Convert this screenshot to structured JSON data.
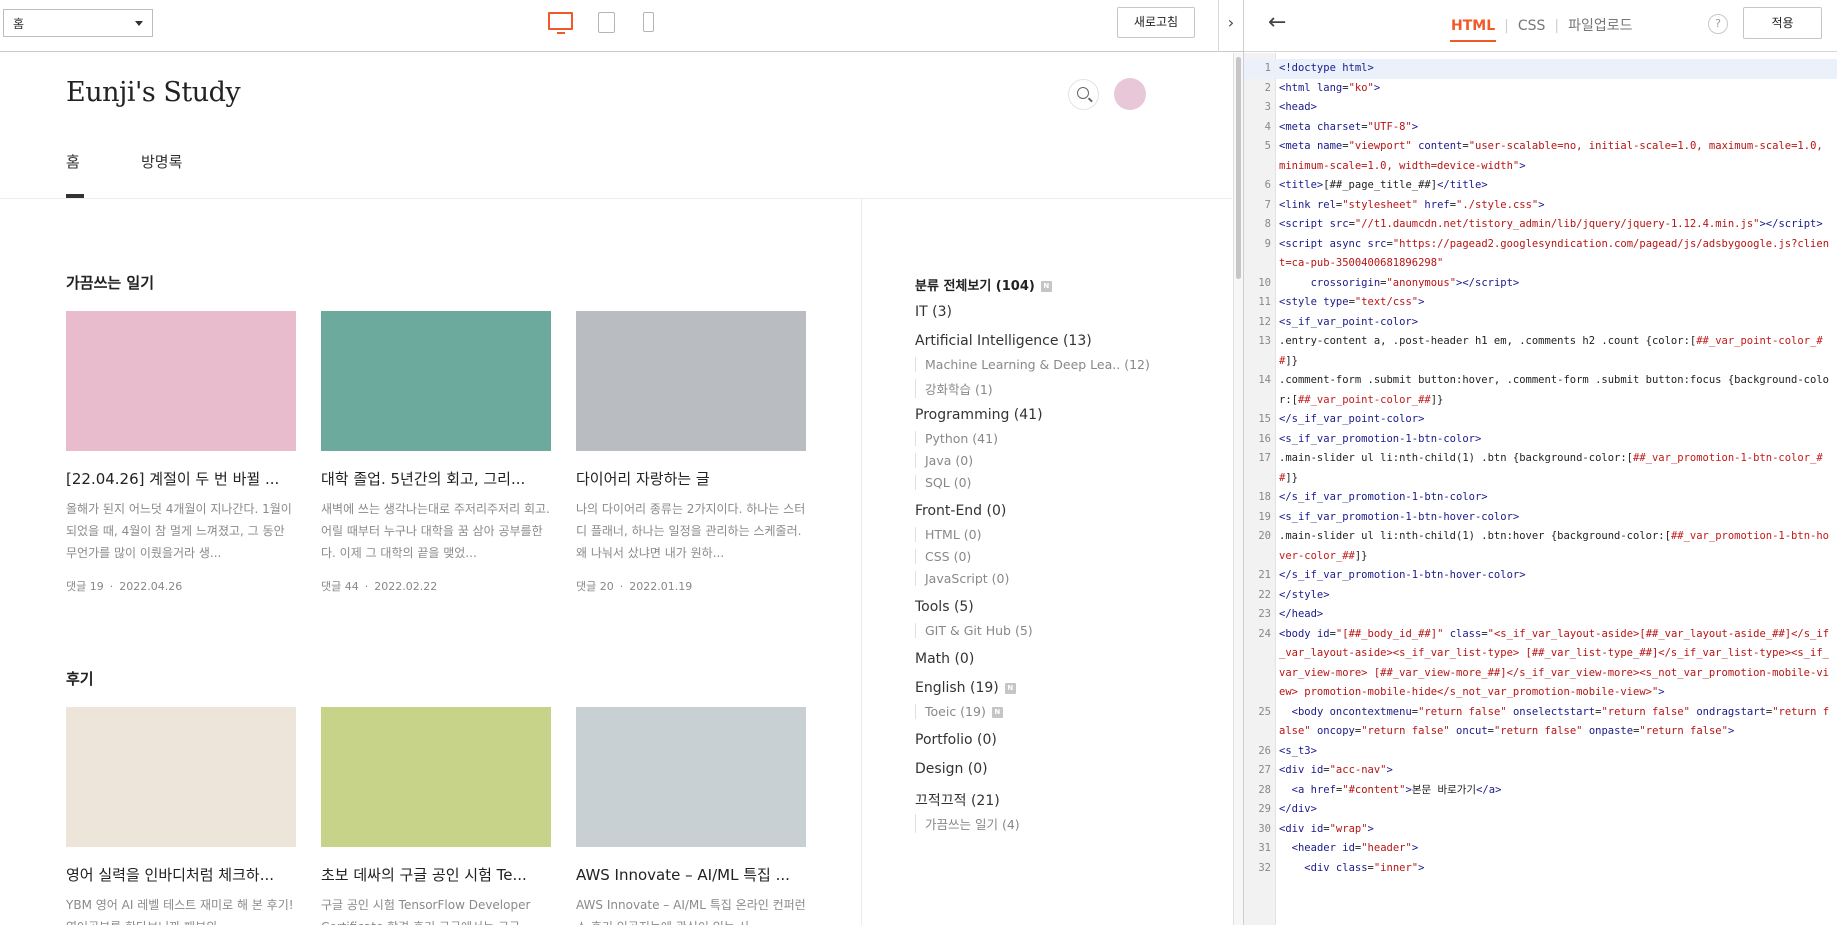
{
  "toolbar": {
    "page_select": "홈",
    "devices": [
      "desktop-icon",
      "tablet-icon",
      "mobile-icon"
    ],
    "refresh_label": "새로고침",
    "collapse_glyph": "›"
  },
  "blog": {
    "title": "Eunji's Study",
    "nav": [
      "홈",
      "방명록"
    ],
    "sections": [
      {
        "title": "가끔쓰는 일기",
        "posts": [
          {
            "title": "[22.04.26] 계절이 두 번 바뀔 ...",
            "excerpt": "올해가 된지 어느덧 4개월이 지나간다. 1월이 되었을 때, 4월이 참 멀게 느껴졌고, 그 동안 무언가를 많이 이뤘을거라 생...",
            "comments": "댓글 19",
            "date": "2022.04.26",
            "color": "#e8bccc"
          },
          {
            "title": "대학 졸업. 5년간의 회고, 그리...",
            "excerpt": "새벽에 쓰는 생각나는대로 주저리주저리 회고. 어릴 때부터 누구나 대학을 꿈 삼아 공부를한다. 이제 그 대학의 끝을 맺었...",
            "comments": "댓글 44",
            "date": "2022.02.22",
            "color": "#6caa9d"
          },
          {
            "title": "다이어리 자랑하는 글",
            "excerpt": "나의 다이어리 종류는 2가지이다. 하나는 스터디 플래너, 하나는 일정을 관리하는 스케줄러. 왜 나눠서 샀냐면 내가 원하...",
            "comments": "댓글 20",
            "date": "2022.01.19",
            "color": "#b9bcc0"
          }
        ]
      },
      {
        "title": "후기",
        "posts": [
          {
            "title": "영어 실력을 인바디처럼 체크하...",
            "excerpt": "YBM 영어 AI 레벨 테스트 재미로 해 본 후기! 영어공부를 한다보니까 패부의",
            "comments": "",
            "date": "",
            "color": "#ede5da"
          },
          {
            "title": "초보 데싸의 구글 공인 시험 Te...",
            "excerpt": "구글 공인 시험 TensorFlow Developer Certificate 합격 후기 구글에서는 구글",
            "comments": "",
            "date": "",
            "color": "#c8d38a"
          },
          {
            "title": "AWS Innovate – AI/ML 특집 ...",
            "excerpt": "AWS Innovate – AI/ML 특집 온라인 컨퍼런스 후기 인공지능에 관심이 있는 사",
            "comments": "",
            "date": "",
            "color": "#c8d0d3"
          }
        ]
      }
    ],
    "categories": [
      {
        "label": "분류 전체보기 (104)",
        "level": "top",
        "badge": "N"
      },
      {
        "label": "IT (3)",
        "level": "main"
      },
      {
        "label": "Artificial Intelligence (13)",
        "level": "main"
      },
      {
        "label": "Machine Learning & Deep Lea.. (12)",
        "level": "sub"
      },
      {
        "label": "강화학습 (1)",
        "level": "sub"
      },
      {
        "label": "Programming (41)",
        "level": "main"
      },
      {
        "label": "Python (41)",
        "level": "sub"
      },
      {
        "label": "Java (0)",
        "level": "sub"
      },
      {
        "label": "SQL (0)",
        "level": "sub"
      },
      {
        "label": "Front-End (0)",
        "level": "main"
      },
      {
        "label": "HTML (0)",
        "level": "sub"
      },
      {
        "label": "CSS (0)",
        "level": "sub"
      },
      {
        "label": "JavaScript (0)",
        "level": "sub"
      },
      {
        "label": "Tools (5)",
        "level": "main"
      },
      {
        "label": "GIT & Git Hub (5)",
        "level": "sub"
      },
      {
        "label": "Math (0)",
        "level": "main"
      },
      {
        "label": "English (19)",
        "level": "main",
        "badge": "N"
      },
      {
        "label": "Toeic (19)",
        "level": "sub",
        "badge": "N"
      },
      {
        "label": "Portfolio (0)",
        "level": "main"
      },
      {
        "label": "Design (0)",
        "level": "main"
      },
      {
        "label": "끄적끄적 (21)",
        "level": "main"
      },
      {
        "label": "가끔쓰는 일기 (4)",
        "level": "sub"
      }
    ]
  },
  "editor": {
    "back_glyph": "←",
    "tabs": [
      "HTML",
      "CSS",
      "파일업로드"
    ],
    "help_glyph": "?",
    "apply_label": "적용",
    "code_lines": [
      {
        "n": "1",
        "html": "<span class='t'>&lt;!doctype html&gt;</span>"
      },
      {
        "n": "2",
        "html": "<span class='t'>&lt;html</span> <span class='a'>lang</span>=<span class='v'>\"ko\"</span><span class='t'>&gt;</span>"
      },
      {
        "n": "3",
        "html": "<span class='t'>&lt;head&gt;</span>"
      },
      {
        "n": "4",
        "html": "<span class='t'>&lt;meta</span> <span class='a'>charset</span>=<span class='v'>\"UTF-8\"</span><span class='t'>&gt;</span>"
      },
      {
        "n": "5",
        "html": "<span class='t'>&lt;meta</span> <span class='a'>name</span>=<span class='v'>\"viewport\"</span> <span class='a'>content</span>=<span class='v'>\"user-scalable=no, initial-scale=1.0, maximum-scale=1.0, minimum-scale=1.0, width=device-width\"</span><span class='t'>&gt;</span>"
      },
      {
        "n": "6",
        "html": "<span class='t'>&lt;title&gt;</span>[##_page_title_##]<span class='t'>&lt;/title&gt;</span>"
      },
      {
        "n": "7",
        "html": "<span class='t'>&lt;link</span> <span class='a'>rel</span>=<span class='v'>\"stylesheet\"</span> <span class='a'>href</span>=<span class='v'>\"./style.css\"</span><span class='t'>&gt;</span>"
      },
      {
        "n": "8",
        "html": "<span class='t'>&lt;script</span> <span class='a'>src</span>=<span class='v'>\"//t1.daumcdn.net/tistory_admin/lib/jquery/jquery-1.12.4.min.js\"</span><span class='t'>&gt;</span><span class='t'>&lt;/script&gt;</span>"
      },
      {
        "n": "9",
        "html": "<span class='t'>&lt;script</span> <span class='a'>async</span> <span class='a'>src</span>=<span class='v'>\"https://pagead2.googlesyndication.com/pagead/js/adsbygoogle.js?client=ca-pub-3500400681896298\"</span>"
      },
      {
        "n": "10",
        "html": "     <span class='a'>crossorigin</span>=<span class='v'>\"anonymous\"</span><span class='t'>&gt;&lt;/script&gt;</span>"
      },
      {
        "n": "11",
        "html": "<span class='t'>&lt;style</span> <span class='a'>type</span>=<span class='v'>\"text/css\"</span><span class='t'>&gt;</span>"
      },
      {
        "n": "12",
        "html": "<span class='t'>&lt;s_if_var_point-color&gt;</span>"
      },
      {
        "n": "13",
        "html": ".entry-content a, .post-header h1 em, .comments h2 .count {color:[<span class='hl'>##_var_point-color_##</span>]}"
      },
      {
        "n": "14",
        "html": ".comment-form .submit button:hover, .comment-form .submit button:focus {background-color:[<span class='hl'>##_var_point-color_##</span>]}"
      },
      {
        "n": "15",
        "html": "<span class='t'>&lt;/s_if_var_point-color&gt;</span>"
      },
      {
        "n": "16",
        "html": "<span class='t'>&lt;s_if_var_promotion-1-btn-color&gt;</span>"
      },
      {
        "n": "17",
        "html": ".main-slider ul li:nth-child(1) .btn {background-color:[<span class='hl'>##_var_promotion-1-btn-color_##</span>]}"
      },
      {
        "n": "18",
        "html": "<span class='t'>&lt;/s_if_var_promotion-1-btn-color&gt;</span>"
      },
      {
        "n": "19",
        "html": "<span class='t'>&lt;s_if_var_promotion-1-btn-hover-color&gt;</span>"
      },
      {
        "n": "20",
        "html": ".main-slider ul li:nth-child(1) .btn:hover {background-color:[<span class='hl'>##_var_promotion-1-btn-hover-color_##</span>]}"
      },
      {
        "n": "21",
        "html": "<span class='t'>&lt;/s_if_var_promotion-1-btn-hover-color&gt;</span>"
      },
      {
        "n": "22",
        "html": "<span class='t'>&lt;/style&gt;</span>"
      },
      {
        "n": "23",
        "html": "<span class='t'>&lt;/head&gt;</span>"
      },
      {
        "n": "24",
        "html": "<span class='t'>&lt;body</span> <span class='a'>id</span>=<span class='v'>\"[##_body_id_##]\"</span> <span class='a'>class</span>=<span class='v'>\"&lt;s_if_var_layout-aside&gt;[##_var_layout-aside_##]&lt;/s_if_var_layout-aside&gt;&lt;s_if_var_list-type&gt; [##_var_list-type_##]&lt;/s_if_var_list-type&gt;&lt;s_if_var_view-more&gt; [##_var_view-more_##]&lt;/s_if_var_view-more&gt;&lt;s_not_var_promotion-mobile-view&gt; promotion-mobile-hide&lt;/s_not_var_promotion-mobile-view&gt;\"</span><span class='t'>&gt;</span>"
      },
      {
        "n": "25",
        "html": "  <span class='t'>&lt;body</span> <span class='a'>oncontextmenu</span>=<span class='v'>\"return false\"</span> <span class='a'>onselectstart</span>=<span class='v'>\"return false\"</span> <span class='a'>ondragstart</span>=<span class='v'>\"return false\"</span> <span class='a'>oncopy</span>=<span class='v'>\"return false\"</span> <span class='a'>oncut</span>=<span class='v'>\"return false\"</span> <span class='a'>onpaste</span>=<span class='v'>\"return false\"</span><span class='t'>&gt;</span>"
      },
      {
        "n": "26",
        "html": "<span class='t'>&lt;s_t3&gt;</span>"
      },
      {
        "n": "27",
        "html": "<span class='t'>&lt;div</span> <span class='a'>id</span>=<span class='v'>\"acc-nav\"</span><span class='t'>&gt;</span>"
      },
      {
        "n": "28",
        "html": "  <span class='t'>&lt;a</span> <span class='a'>href</span>=<span class='v'>\"#content\"</span><span class='t'>&gt;</span>본문 바로가기<span class='t'>&lt;/a&gt;</span>"
      },
      {
        "n": "29",
        "html": "<span class='t'>&lt;/div&gt;</span>"
      },
      {
        "n": "30",
        "html": "<span class='t'>&lt;div</span> <span class='a'>id</span>=<span class='v'>\"wrap\"</span><span class='t'>&gt;</span>"
      },
      {
        "n": "31",
        "html": "  <span class='t'>&lt;header</span> <span class='a'>id</span>=<span class='v'>\"header\"</span><span class='t'>&gt;</span>"
      },
      {
        "n": "32",
        "html": "    <span class='t'>&lt;div</span> <span class='a'>class</span>=<span class='v'>\"inner\"</span><span class='t'>&gt;</span>"
      }
    ]
  }
}
